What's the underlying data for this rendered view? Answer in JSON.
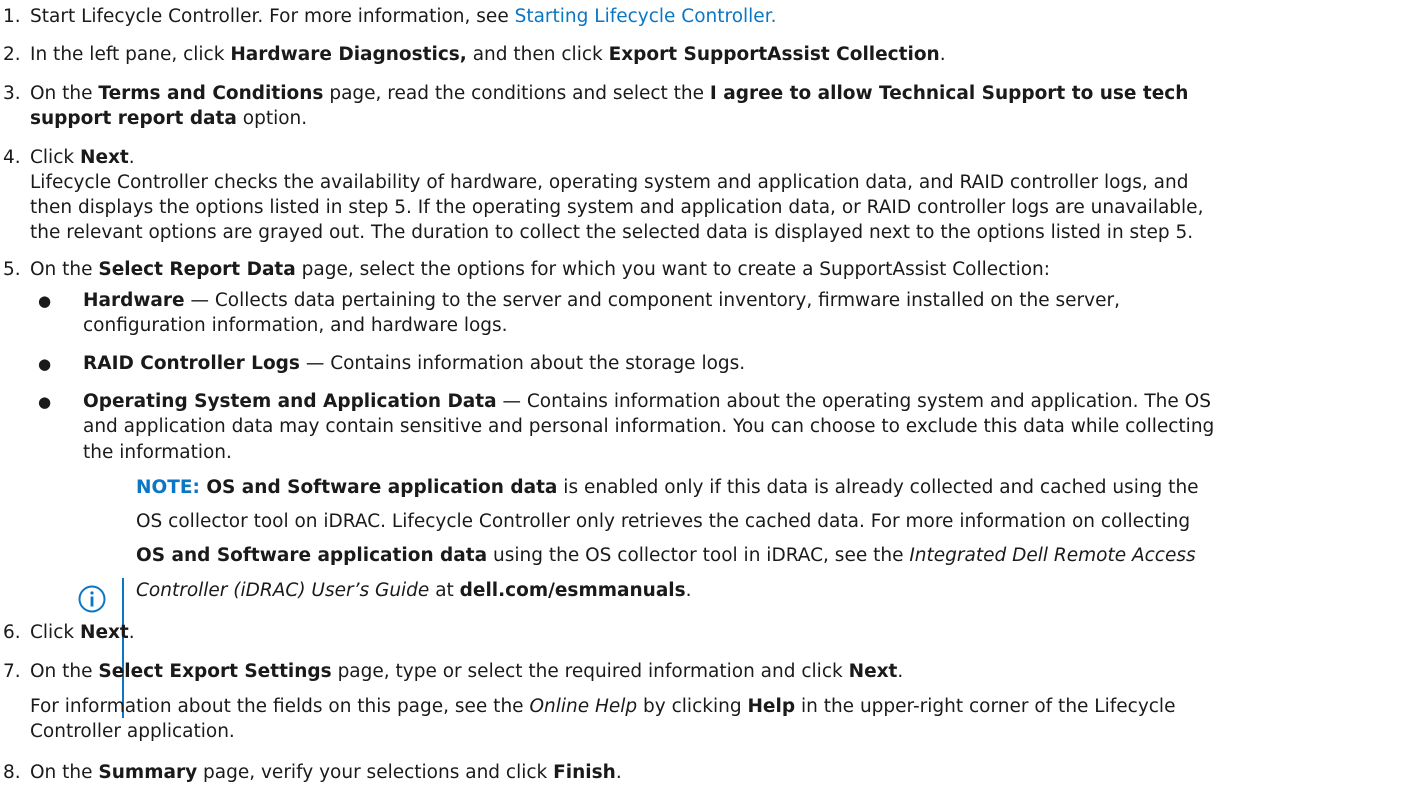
{
  "steps": [
    {
      "num": "1.",
      "pre": "Start Lifecycle Controller. For more information, see ",
      "link": "Starting Lifecycle Controller."
    },
    {
      "num": "2.",
      "a": "In the left pane, click ",
      "b": "Hardware Diagnostics,",
      "c": " and then click ",
      "d": "Export SupportAssist Collection",
      "e": "."
    },
    {
      "num": "3.",
      "l1a": "On the ",
      "l1b": "Terms and Conditions",
      "l1c": " page, read the conditions and select the ",
      "l1d": "I agree to allow Technical Support to use tech",
      "l2a": "support report data",
      "l2b": " option."
    },
    {
      "num": "4.",
      "a": "Click ",
      "b": "Next",
      "c": ".",
      "para": [
        "Lifecycle Controller checks the availability of hardware, operating system and application data, and RAID controller logs, and",
        "then displays the options listed in step 5. If the operating system and application data, or RAID controller logs are unavailable,",
        "the relevant options are grayed out. The duration to collect the selected data is displayed next to the options listed in step 5."
      ]
    },
    {
      "num": "5.",
      "a": "On the ",
      "b": "Select Report Data",
      "c": " page, select the options for which you want to create a SupportAssist Collection:"
    },
    {
      "num": "6.",
      "a": "Click ",
      "b": "Next",
      "c": "."
    },
    {
      "num": "7.",
      "a": "On the ",
      "b": "Select Export Settings",
      "c": " page, type or select the required information and click ",
      "d": "Next",
      "e": ".",
      "p1a": "For information about the fields on this page, see the ",
      "p1b": "Online Help",
      "p1c": " by clicking ",
      "p1d": "Help",
      "p1e": " in the upper-right corner of the Lifecycle",
      "p2": "Controller application."
    },
    {
      "num": "8.",
      "a": "On the ",
      "b": "Summary",
      "c": " page, verify your selections and click ",
      "d": "Finish",
      "e": "."
    }
  ],
  "bullets": [
    {
      "glyph": "●",
      "title": "Hardware",
      "l1": " — Collects data pertaining to the server and component inventory, firmware installed on the server,",
      "l2": "configuration information, and hardware logs."
    },
    {
      "glyph": "●",
      "title": "RAID Controller Logs",
      "l1": " — Contains information about the storage logs."
    },
    {
      "glyph": "●",
      "title": "Operating System and Application Data",
      "l1": " — Contains information about the operating system and application. The OS",
      "l2": "and application data may contain sensitive and personal information. You can choose to exclude this data while collecting",
      "l3": "the information."
    }
  ],
  "note": {
    "label": "NOTE:",
    "l1a": " OS and Software application data",
    "l1b": " is enabled only if this data is already collected and cached using the",
    "l2": "OS collector tool on iDRAC. Lifecycle Controller only retrieves the cached data. For more information on collecting",
    "l3a": "OS and Software application data",
    "l3b": " using the OS collector tool in iDRAC, see the ",
    "l3c": "Integrated Dell Remote Access",
    "l4a": "Controller (iDRAC) User’s Guide",
    "l4b": " at ",
    "l4c": "dell.com/esmmanuals",
    "l4d": ".",
    "icon": "info-icon",
    "accent": "#0a76c5"
  },
  "colors": {
    "link": "#0a76c5",
    "text": "#1a1a1a"
  }
}
